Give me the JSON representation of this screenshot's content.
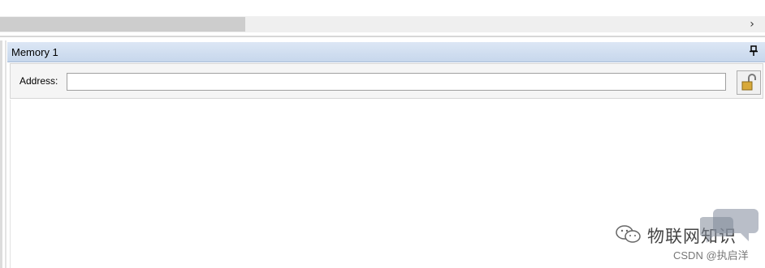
{
  "scrollbar": {
    "right_arrow": "›"
  },
  "memory_panel": {
    "title": "Memory 1",
    "pin_icon": "pin-icon",
    "address_label": "Address:",
    "address_value": "",
    "lock_icon": "unlocked-padlock-icon"
  },
  "watermark": {
    "logo_icon": "wechat-icon",
    "main_text": "物联网知识",
    "sub_text": "CSDN @执启洋"
  }
}
